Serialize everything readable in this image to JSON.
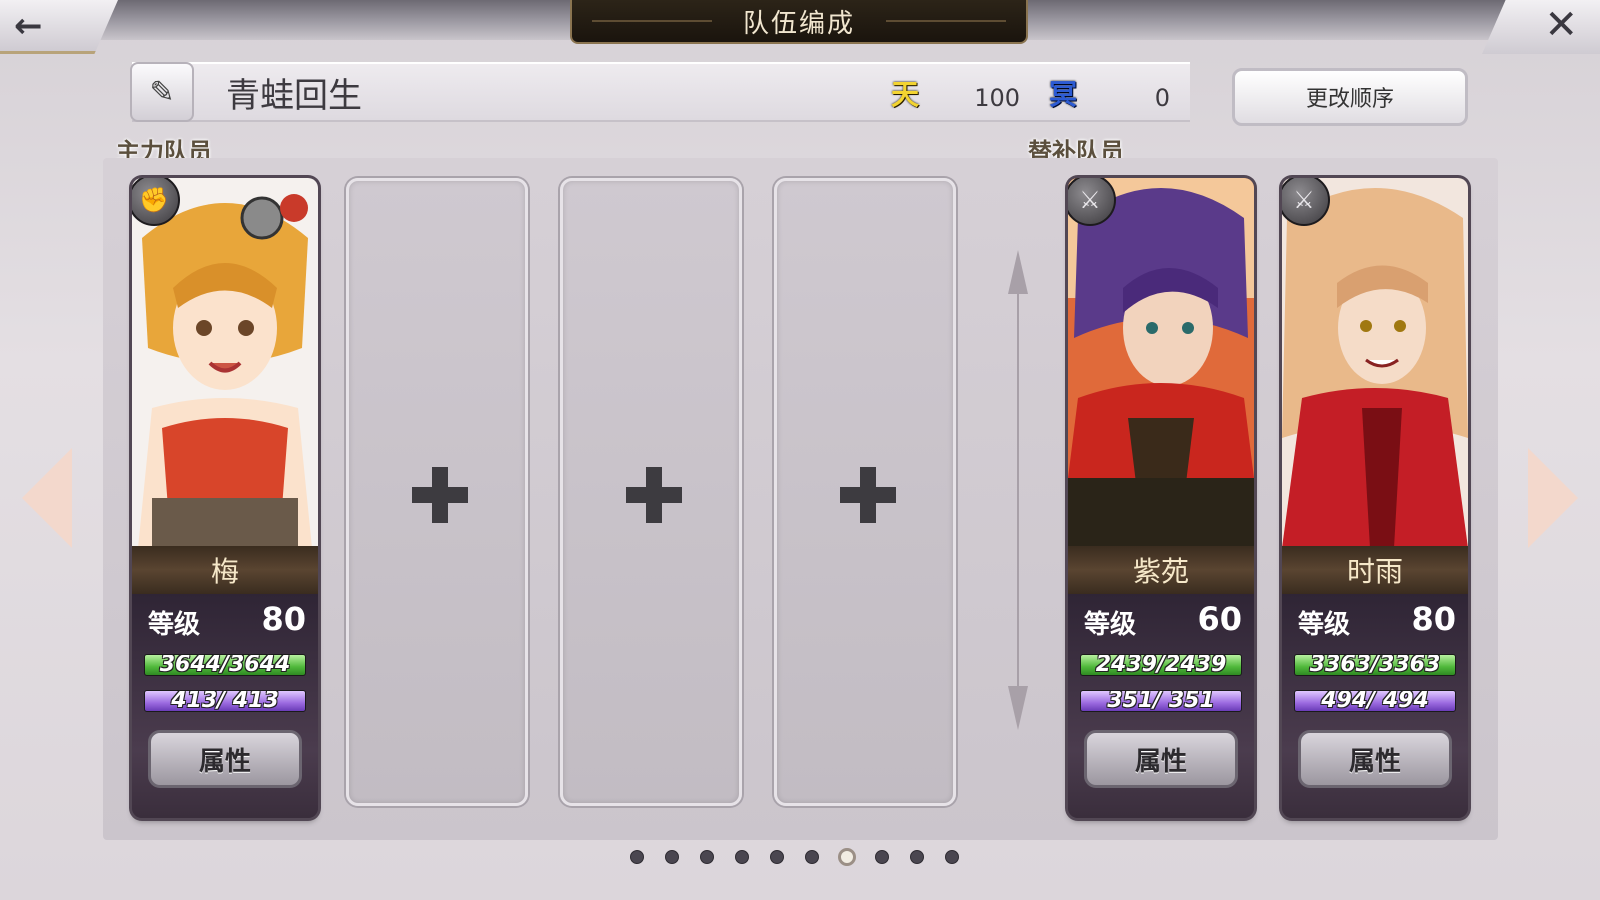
{
  "header": {
    "title": "队伍编成",
    "back_icon": "arrow-left-icon",
    "close_icon": "close-x-icon"
  },
  "team": {
    "name": "青蛙回生",
    "heaven_label": "天",
    "heaven_value": "100",
    "underworld_label": "冥",
    "underworld_value": "0",
    "order_button": "更改顺序"
  },
  "sections": {
    "main": "主力队员",
    "reserve": "替补队员"
  },
  "main_members": [
    {
      "name": "梅",
      "level_label": "等级",
      "level": "80",
      "hp": "3644/3644",
      "mp": "413/ 413",
      "attr_button": "属性",
      "class_icon": "gauntlet-icon",
      "hp_fraction": 1.0,
      "mp_fraction": 1.0
    }
  ],
  "empty_slots": 3,
  "reserve_members": [
    {
      "name": "紫苑",
      "level_label": "等级",
      "level": "60",
      "hp": "2439/2439",
      "mp": "351/ 351",
      "attr_button": "属性",
      "class_icon": "sword-icon",
      "hp_fraction": 1.0,
      "mp_fraction": 1.0
    },
    {
      "name": "时雨",
      "level_label": "等级",
      "level": "80",
      "hp": "3363/3363",
      "mp": "494/ 494",
      "attr_button": "属性",
      "class_icon": "sword-icon",
      "hp_fraction": 1.0,
      "mp_fraction": 1.0
    }
  ],
  "pagination": {
    "total": 10,
    "active_index": 6
  },
  "colors": {
    "heaven": "#f3d431",
    "underworld": "#2c5bd4",
    "hp": "#4fb83a",
    "mp": "#9b6ae0",
    "nav_arrow": "#f3d8cc"
  }
}
